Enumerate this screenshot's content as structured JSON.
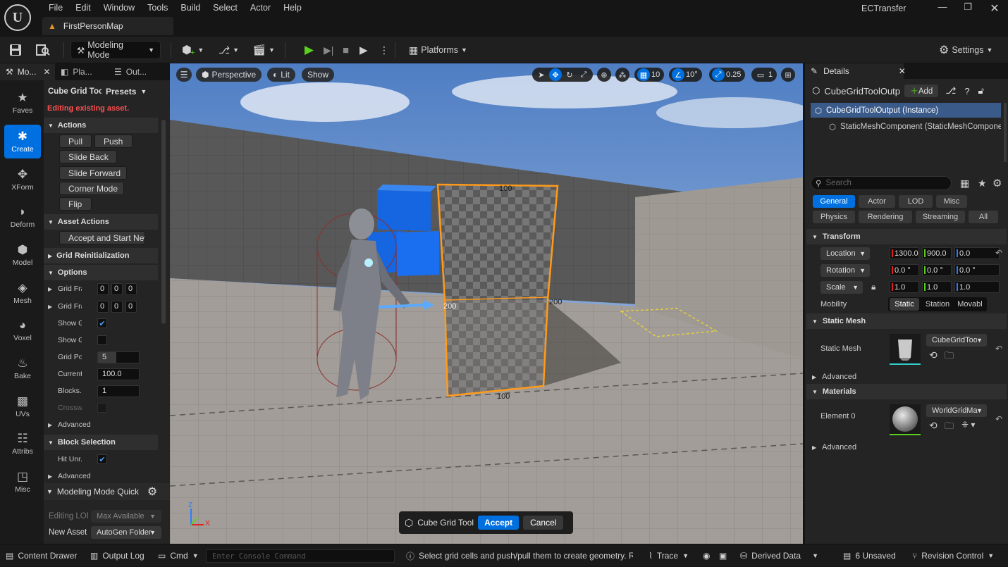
{
  "app": {
    "logo": "U",
    "title": "ECTransfer",
    "map_tab": "FirstPersonMap",
    "menu": [
      "File",
      "Edit",
      "Window",
      "Tools",
      "Build",
      "Select",
      "Actor",
      "Help"
    ]
  },
  "toolbar": {
    "mode": "Modeling Mode",
    "platforms": "Platforms",
    "settings": "Settings"
  },
  "left_tabs": [
    "Mo...",
    "Pla...",
    "Out..."
  ],
  "categories": [
    "Faves",
    "Create",
    "XForm",
    "Deform",
    "Model",
    "Mesh",
    "Voxel",
    "Bake",
    "UVs",
    "Attribs",
    "Misc"
  ],
  "tool_panel": {
    "tool_name": "Cube Grid Tool",
    "presets": "Presets",
    "editing_msg": "Editing existing asset.",
    "actions_header": "Actions",
    "pull": "Pull",
    "push": "Push",
    "slide_back": "Slide Back",
    "slide_forward": "Slide Forward",
    "corner_mode": "Corner Mode",
    "flip": "Flip",
    "asset_actions_header": "Asset Actions",
    "accept_start": "Accept and Start New",
    "grid_reinit": "Grid Reinitialization",
    "options_header": "Options",
    "grid_frame1": "Grid Fra...",
    "grid_frame2": "Grid Fra...",
    "frame_val": "0",
    "show_grid": "Show Grid",
    "show_gizmo": "Show Gi...",
    "grid_power": "Grid Po...",
    "grid_power_val": "5",
    "current": "Current...",
    "current_val": "100.0",
    "blocks": "Blocks...",
    "blocks_val": "1",
    "crosswire": "Crosswi...",
    "advanced1": "Advanced",
    "block_selection_header": "Block Selection",
    "hit_unreal": "Hit Unr...",
    "advanced2": "Advanced",
    "quick_settings": "Modeling Mode Quick Settings",
    "editing_lod_label": "Editing LOD",
    "editing_lod_val": "Max Available",
    "new_asset_label": "New Asset",
    "new_asset_val": "AutoGen Folder"
  },
  "viewport": {
    "perspective": "Perspective",
    "lit": "Lit",
    "show": "Show",
    "grid_snap": "10",
    "rot_snap": "10°",
    "scale_snap": "0.25",
    "cam_speed": "1",
    "dim_top": "100",
    "dim_left": "200",
    "dim_right": "200",
    "dim_bottom": "100",
    "axis_x": "X",
    "axis_z": "Z",
    "confirm_tool": "Cube Grid Tool",
    "accept": "Accept",
    "cancel": "Cancel"
  },
  "details": {
    "tab": "Details",
    "object_name": "CubeGridToolOutput",
    "add": "Add",
    "tree_instance": "CubeGridToolOutput (Instance)",
    "tree_component": "StaticMeshComponent (StaticMeshComponent)",
    "search_placeholder": "Search",
    "filters1": [
      "General",
      "Actor",
      "LOD",
      "Misc"
    ],
    "filters2": [
      "Physics",
      "Rendering",
      "Streaming",
      "All"
    ],
    "transform_header": "Transform",
    "location": "Location",
    "rotation": "Rotation",
    "scale": "Scale",
    "loc": [
      "1300.0",
      "900.0",
      "0.0"
    ],
    "rot": [
      "0.0 °",
      "0.0 °",
      "0.0 °"
    ],
    "scl": [
      "1.0",
      "1.0",
      "1.0"
    ],
    "mobility": "Mobility",
    "mobility_opts": [
      "Static",
      "Station",
      "Movabl"
    ],
    "static_mesh_header": "Static Mesh",
    "static_mesh_label": "Static Mesh",
    "static_mesh_val": "CubeGridTool",
    "advanced": "Advanced",
    "materials_header": "Materials",
    "element0": "Element 0",
    "material_val": "WorldGridMa",
    "advanced2": "Advanced"
  },
  "statusbar": {
    "content_drawer": "Content Drawer",
    "output_log": "Output Log",
    "cmd": "Cmd",
    "console_placeholder": "Enter Console Command",
    "hint": "Select grid cells and push/pull them to create geometry. Ref",
    "trace": "Trace",
    "derived_data": "Derived Data",
    "unsaved": "6 Unsaved",
    "revision_control": "Revision Control"
  },
  "colors": {
    "accent": "#0070e0",
    "selection_outline": "#ff9a1a",
    "editing_text": "#ff5050"
  }
}
